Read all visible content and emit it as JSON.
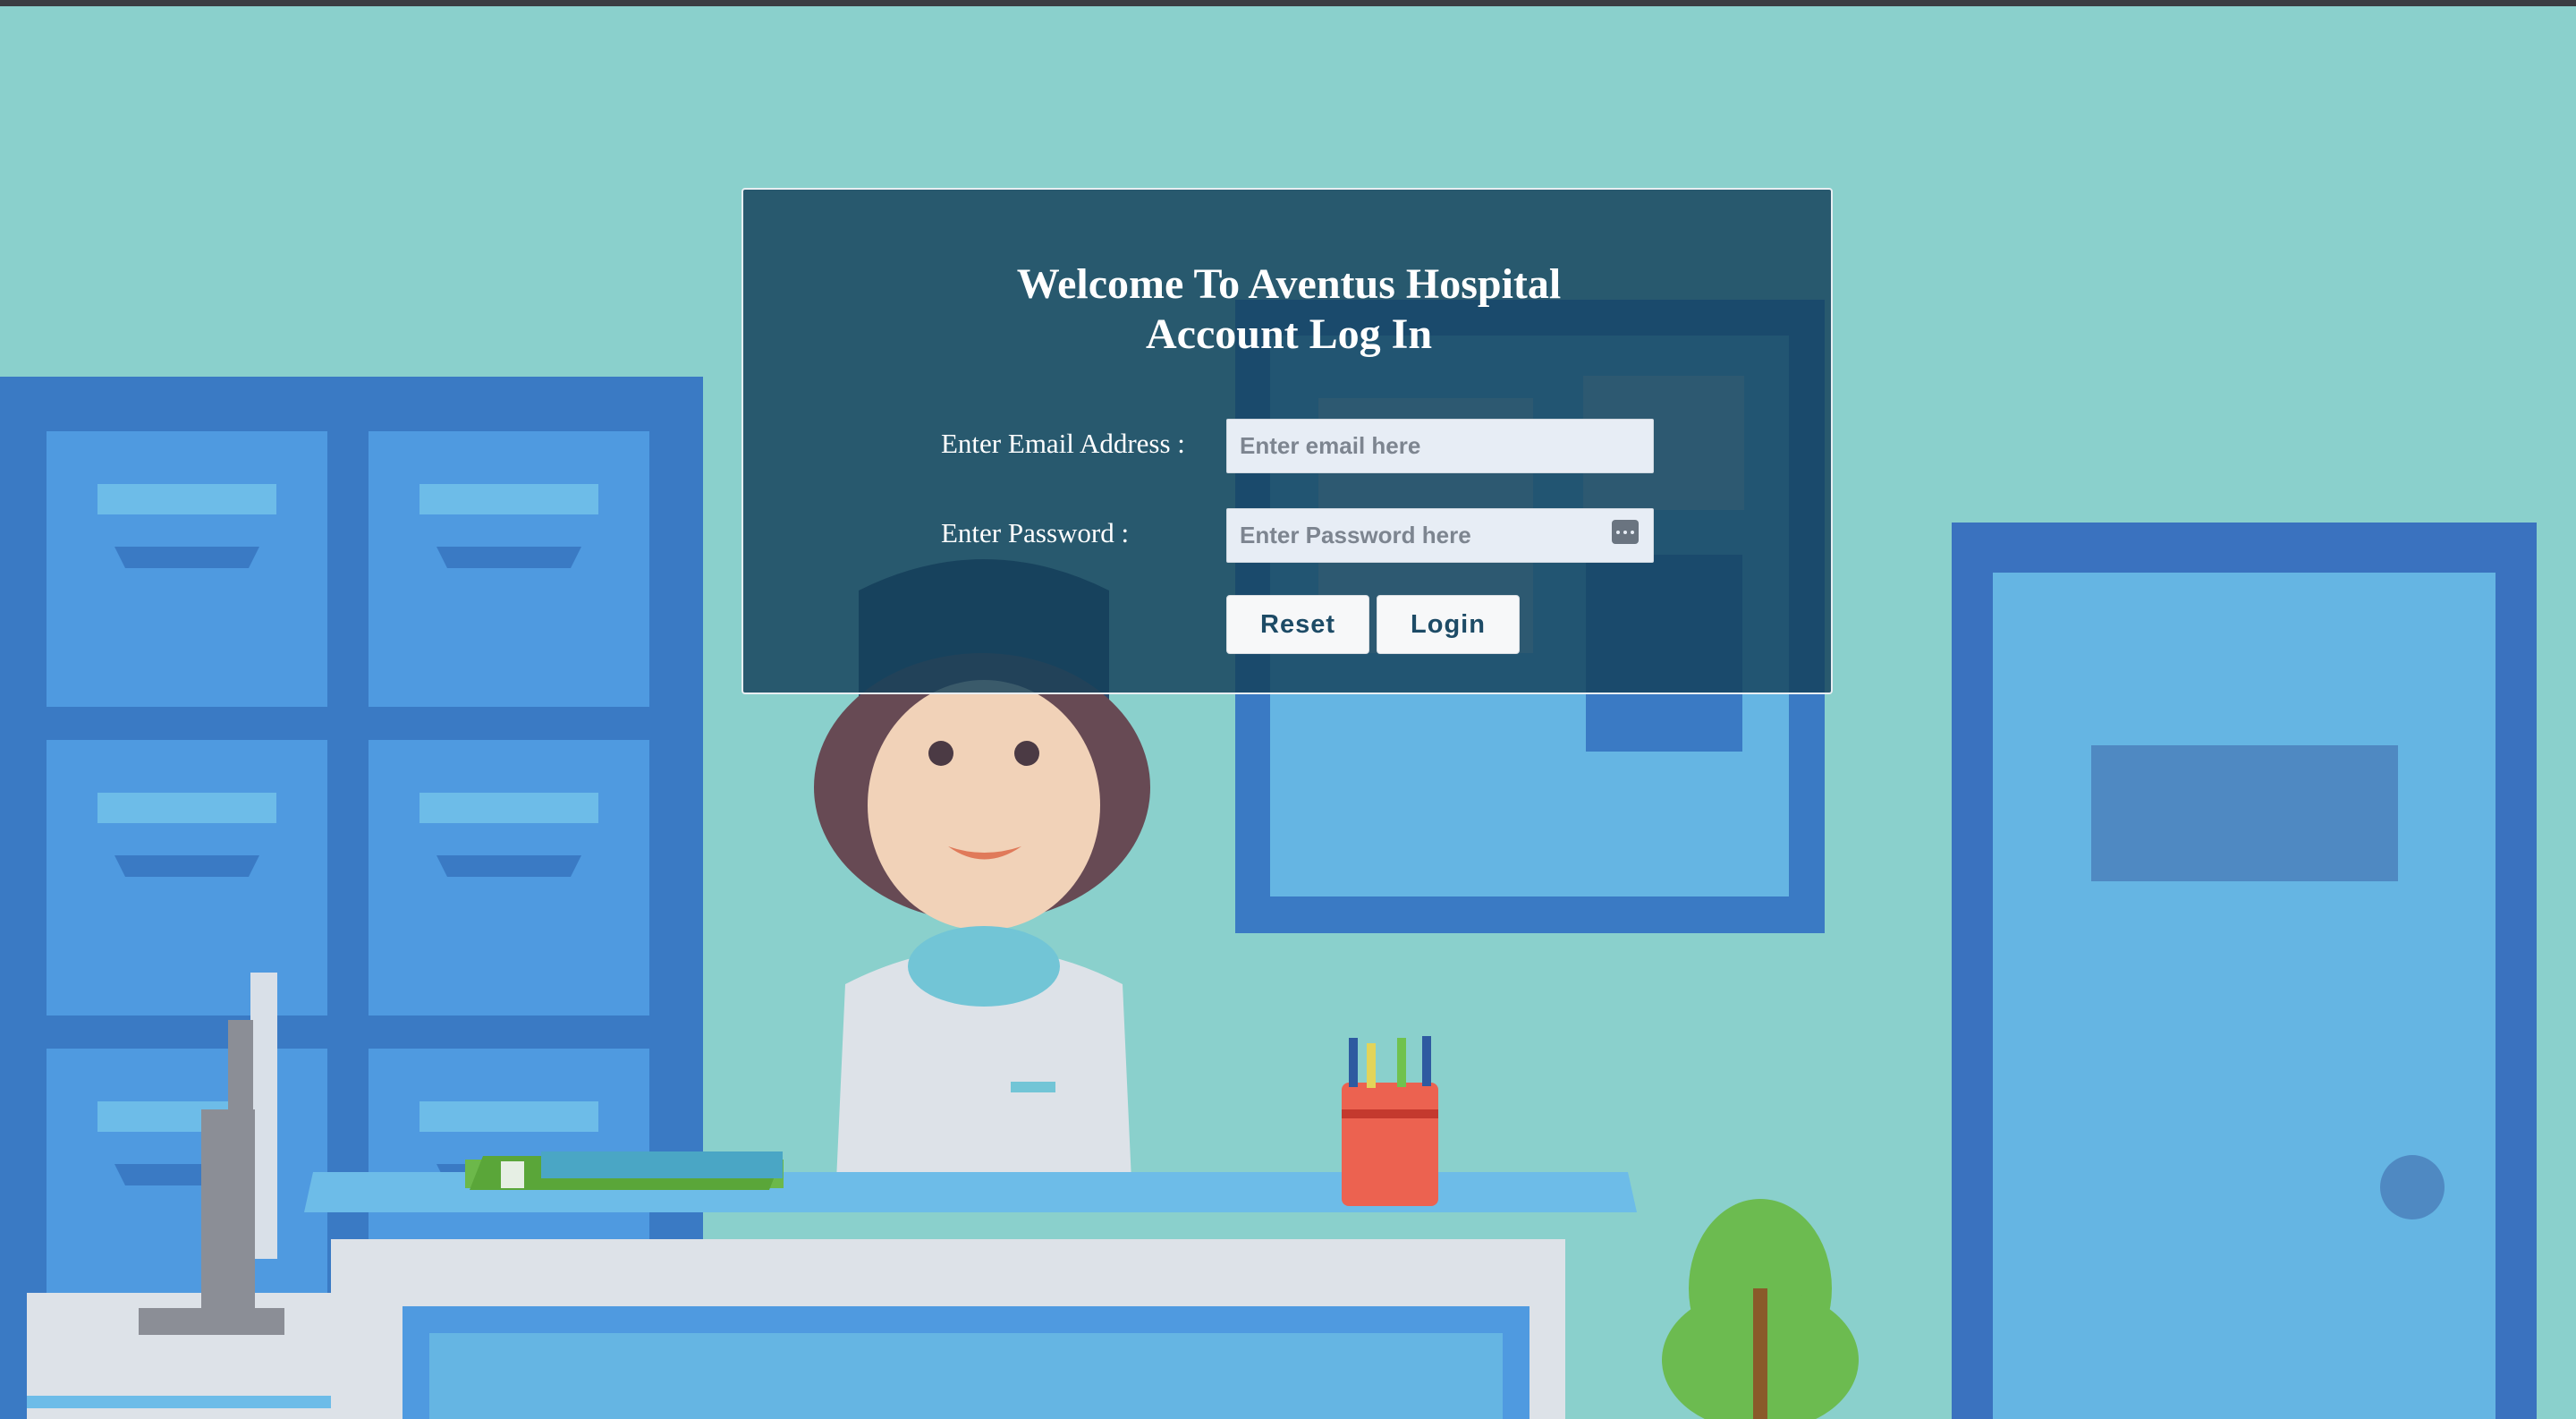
{
  "login": {
    "title_line1": "Welcome To Aventus Hospital",
    "title_line2": "Account Log In",
    "email_label": "Enter Email Address :",
    "email_placeholder": "Enter email here",
    "email_value": "",
    "password_label": "Enter Password :",
    "password_placeholder": "Enter Password here",
    "password_value": "",
    "reset_label": "Reset",
    "login_label": "Login"
  },
  "icons": {
    "password_manager": "password-key-icon"
  },
  "colors": {
    "background": "#8ad0cc",
    "panel": "#14415a",
    "button_text": "#1d4b66"
  }
}
